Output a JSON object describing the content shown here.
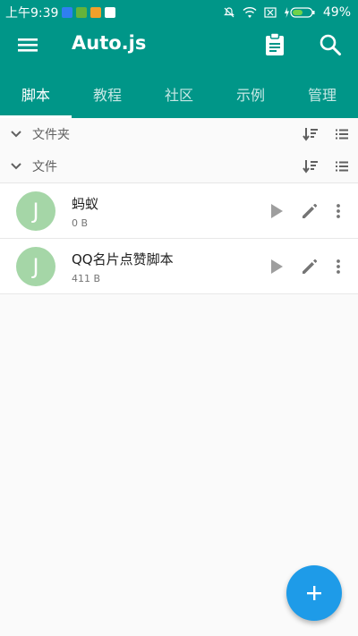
{
  "status_bar": {
    "time": "上午9:39",
    "battery": "49%"
  },
  "toolbar": {
    "title": "Auto.js",
    "menu_icon": "menu-icon",
    "clipboard_icon": "clipboard-icon",
    "search_icon": "search-icon"
  },
  "tabs": [
    {
      "label": "脚本",
      "active": true
    },
    {
      "label": "教程",
      "active": false
    },
    {
      "label": "社区",
      "active": false
    },
    {
      "label": "示例",
      "active": false
    },
    {
      "label": "管理",
      "active": false
    }
  ],
  "groups": [
    {
      "label": "文件夹"
    },
    {
      "label": "文件"
    }
  ],
  "files": [
    {
      "avatar": "J",
      "name": "蚂蚁",
      "size": "0 B"
    },
    {
      "avatar": "J",
      "name": "QQ名片点赞脚本",
      "size": "411 B"
    }
  ],
  "colors": {
    "primary": "#009688",
    "fab": "#1e9be8",
    "avatar": "#a5d6a7"
  }
}
